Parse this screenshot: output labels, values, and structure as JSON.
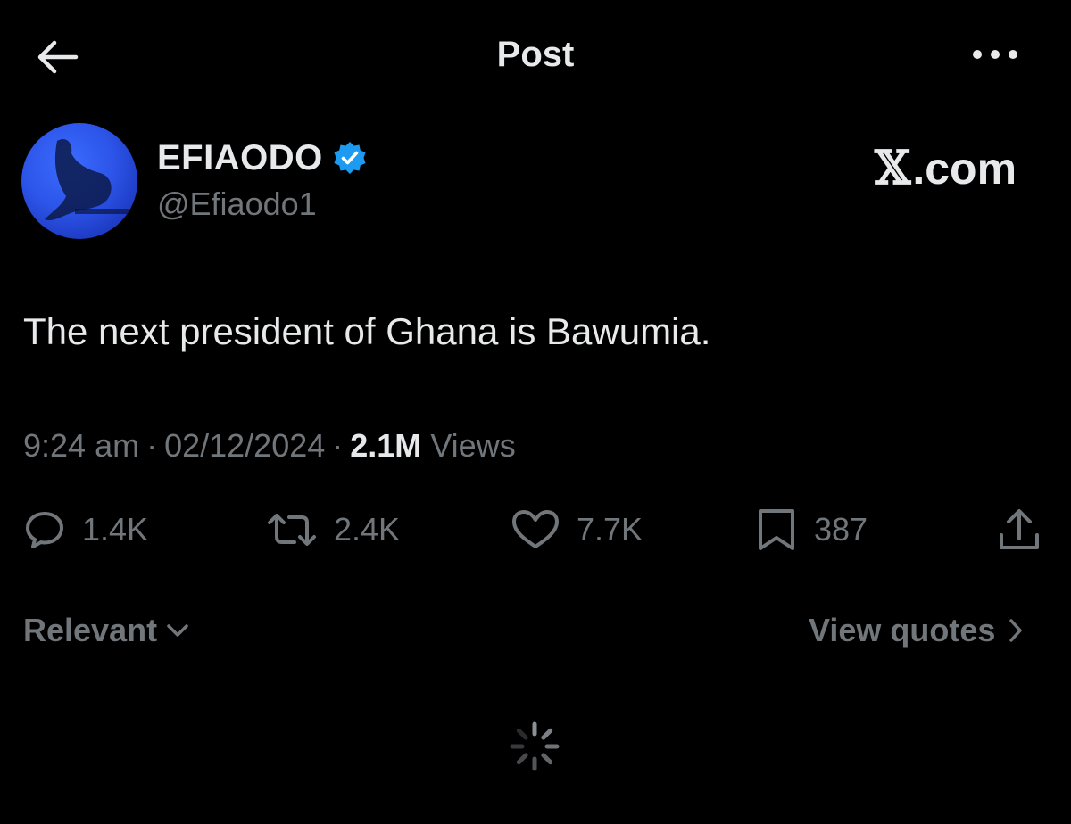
{
  "header": {
    "title": "Post"
  },
  "author": {
    "display_name": "EFIAODO",
    "handle": "@Efiaodo1",
    "verified": true
  },
  "watermark": {
    "x_glyph": "𝕏",
    "suffix": ".com"
  },
  "post": {
    "text": "The next president of Ghana is Bawumia."
  },
  "meta": {
    "time": "9:24 am",
    "date": "02/12/2024",
    "separator": "·",
    "views_count": "2.1M",
    "views_label": "Views"
  },
  "actions": {
    "replies": "1.4K",
    "reposts": "2.4K",
    "likes": "7.7K",
    "bookmarks": "387"
  },
  "bottom": {
    "sort_label": "Relevant",
    "view_quotes_label": "View quotes"
  },
  "colors": {
    "background": "#000000",
    "primary_text": "#e7e9ea",
    "secondary_text": "#71767b",
    "verified_blue": "#1d9bf0",
    "avatar_blue": "#2c54e8"
  },
  "icons": {
    "back": "arrow-left-icon",
    "more": "more-horizontal-icon",
    "verified": "verified-badge-icon",
    "reply": "reply-icon",
    "repost": "repost-icon",
    "like": "heart-icon",
    "bookmark": "bookmark-icon",
    "share": "share-icon",
    "sort": "chevron-down-icon",
    "quotes": "chevron-right-icon",
    "loading": "spinner-icon"
  }
}
